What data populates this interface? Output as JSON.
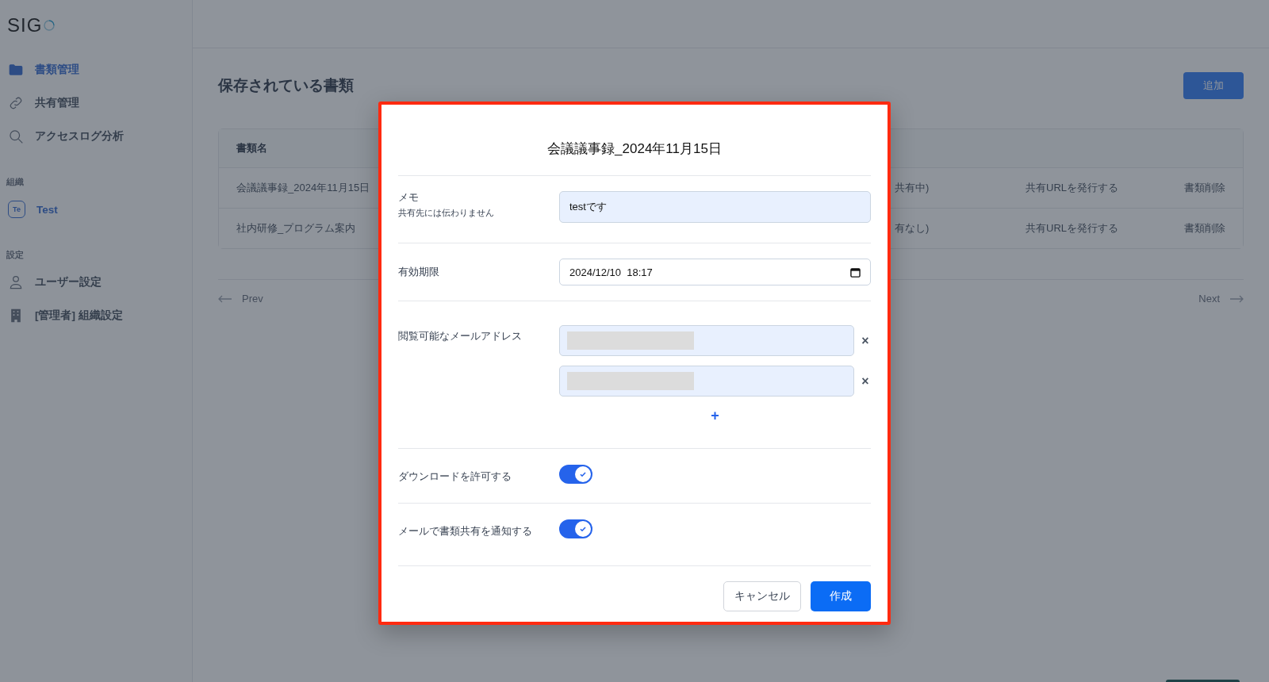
{
  "logo": {
    "text": "SIG"
  },
  "nav": [
    {
      "label": "書類管理",
      "selected": true
    },
    {
      "label": "共有管理",
      "selected": false
    },
    {
      "label": "アクセスログ分析",
      "selected": false
    }
  ],
  "org_section": {
    "heading": "組織",
    "items": [
      {
        "badge": "Te",
        "label": "Test",
        "selected": true
      }
    ]
  },
  "settings_section": {
    "heading": "設定",
    "items": [
      {
        "label": "ユーザー設定",
        "selected": false
      },
      {
        "label": "[管理者] 組織設定",
        "selected": false
      }
    ]
  },
  "page": {
    "title": "保存されている書類",
    "add_button": "追加"
  },
  "table": {
    "columns": [
      "書類名"
    ],
    "rows": [
      {
        "name": "会議議事録_2024年11月15日",
        "status": "共有中)",
        "share": "共有URLを発行する",
        "delete": "書類削除"
      },
      {
        "name": "社内研修_プログラム案内",
        "status": "有なし)",
        "share": "共有URLを発行する",
        "delete": "書類削除"
      }
    ]
  },
  "pagination": {
    "prev": "Prev",
    "next": "Next"
  },
  "dialog": {
    "title": "会議議事録_2024年11月15日",
    "memo": {
      "label": "メモ",
      "hint": "共有先には伝わりません",
      "value": "testです"
    },
    "expiry": {
      "label": "有効期限",
      "value": "2024/12/10  18:17"
    },
    "emails": {
      "label": "閲覧可能なメールアドレス",
      "items": [
        {
          "kind": "redacted",
          "remove": "×"
        },
        {
          "kind": "redacted",
          "remove": "×"
        }
      ],
      "add": "+"
    },
    "toggles": [
      {
        "label": "ダウンロードを許可する",
        "on": true
      },
      {
        "label": "メールで書類共有を通知する",
        "on": true
      }
    ],
    "cancel": "キャンセル",
    "submit": "作成"
  }
}
